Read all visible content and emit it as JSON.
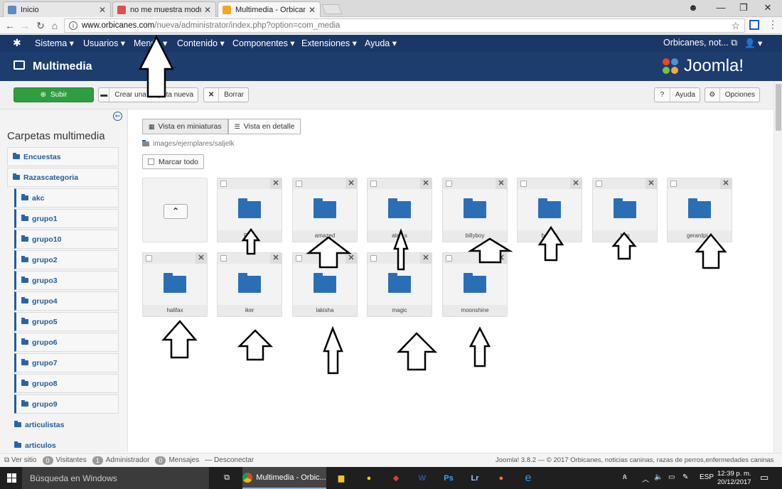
{
  "browser": {
    "tabs": [
      {
        "label": "Inicio",
        "favicon_color": "#5b8cc4"
      },
      {
        "label": "no me muestra modulos",
        "favicon_color": "#d9534f"
      },
      {
        "label": "Multimedia - Orbicanes",
        "favicon_color": "#f5a623"
      }
    ],
    "url_host": "www.orbicanes.com",
    "url_path": "/nueva/administrator/index.php?option=com_media"
  },
  "joomla_nav": {
    "menus": [
      "Sistema ▾",
      "Usuarios ▾",
      "Menús ▾",
      "Contenido ▾",
      "Componentes ▾",
      "Extensiones ▾",
      "Ayuda ▾"
    ],
    "site_link": "Orbicanes, not...",
    "user_menu": "▾"
  },
  "header": {
    "title": "Multimedia",
    "brand": "Joomla!"
  },
  "toolbar": {
    "upload": "Subir",
    "new_folder": "Crear una carpeta nueva",
    "delete": "Borrar",
    "help": "Ayuda",
    "options": "Opciones"
  },
  "sidebar": {
    "title": "Carpetas multimedia",
    "folders": [
      {
        "label": "Encuestas",
        "sub": false
      },
      {
        "label": "Razascategoria",
        "sub": false
      },
      {
        "label": "akc",
        "sub": true
      },
      {
        "label": "grupo1",
        "sub": true
      },
      {
        "label": "grupo10",
        "sub": true
      },
      {
        "label": "grupo2",
        "sub": true
      },
      {
        "label": "grupo3",
        "sub": true
      },
      {
        "label": "grupo4",
        "sub": true
      },
      {
        "label": "grupo5",
        "sub": true
      },
      {
        "label": "grupo6",
        "sub": true
      },
      {
        "label": "grupo7",
        "sub": true
      },
      {
        "label": "grupo8",
        "sub": true
      },
      {
        "label": "grupo9",
        "sub": true
      },
      {
        "label": "articulistas",
        "sub": false
      },
      {
        "label": "articulos",
        "sub": false
      }
    ]
  },
  "main": {
    "view_thumbs": "Vista en miniaturas",
    "view_detail": "Vista en detalle",
    "path": "images/ejemplares/saljelk",
    "mark_all": "Marcar todo",
    "folders": [
      "Fo...",
      "amazed",
      "ate...s",
      "billyboy",
      "bo...er",
      "f...n",
      "gerardpi...",
      "halifax",
      "iker",
      "lakisha",
      "magic",
      "moonshine"
    ]
  },
  "status": {
    "view_site": "Ver sitio",
    "visitors_count": "0",
    "visitors": "Visitantes",
    "admin_count": "1",
    "admin": "Administrador",
    "messages_count": "0",
    "messages": "Mensajes",
    "logout": "Desconectar",
    "copyright": "Joomla! 3.8.2 — © 2017 Orbicanes, noticias caninas, razas de perros,enfermedades caninas"
  },
  "taskbar": {
    "search": "Búsqueda en Windows",
    "active_app": "Multimedia - Orbic...",
    "lang": "ESP",
    "time": "12:39 p. m.",
    "date": "20/12/2017"
  }
}
